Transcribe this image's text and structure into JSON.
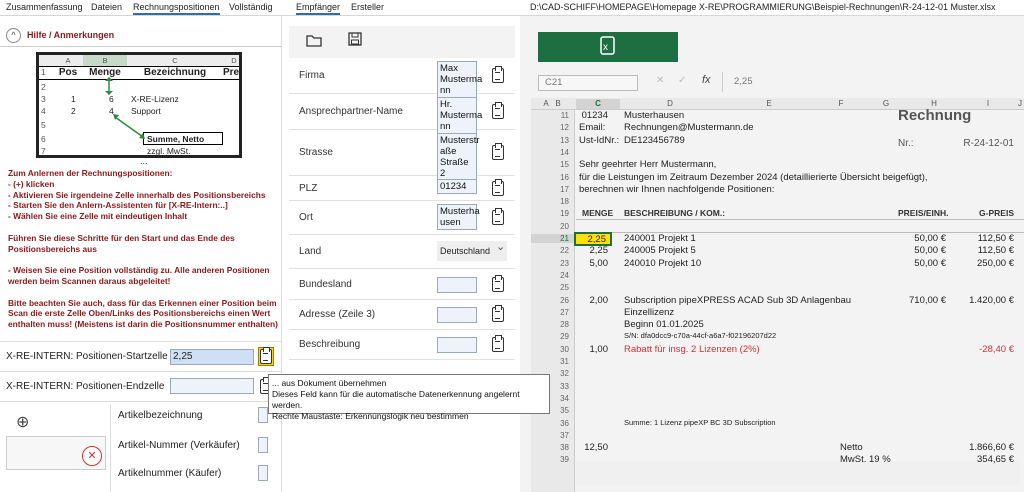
{
  "tabs_left": [
    "Zusammenfassung",
    "Dateien",
    "Rechnungspositionen",
    "Vollständig"
  ],
  "tabs_mid": [
    "Empfänger",
    "Ersteller"
  ],
  "file_path": "D:\\CAD-SCHIFF\\HOMEPAGE\\Homepage X-RE\\PROGRAMMIERUNG\\Beispiel-Rechnungen\\R-24-12-01 Muster.xlsx",
  "hilfe": {
    "toggle": "^",
    "title": "Hilfe / Anmerkungen"
  },
  "sheet": {
    "cols": [
      "A",
      "B",
      "C",
      "D"
    ],
    "headers": [
      "Pos",
      "Menge",
      "Bezeichnung",
      "Pre"
    ],
    "rows": [
      {
        "n": "1"
      },
      {
        "n": "2"
      },
      {
        "n": "3",
        "pos": "1",
        "menge": "6",
        "bez": "X-RE-Lizenz"
      },
      {
        "n": "4",
        "pos": "2",
        "menge": "4",
        "bez": "Support"
      },
      {
        "n": "5"
      },
      {
        "n": "6",
        "bez": "Summe, Netto"
      },
      {
        "n": "7",
        "bez": "zzgl. MwSt."
      }
    ],
    "more": "..."
  },
  "instructions": [
    "Zum Anlernen der Rechnungspositionen:",
    "- (+) klicken",
    "- Aktivieren Sie irgendeine Zelle innerhalb des Positionsbereichs",
    "- Starten Sie den Anlern-Assistenten für [X-RE-Intern:..]",
    "- Wählen Sie eine Zelle mit eindeutigen Inhalt",
    "",
    "Führen Sie diese Schritte für den Start und das Ende des",
    "Positionsbereichs aus",
    "",
    "- Weisen Sie eine Position vollständig zu. Alle anderen Positionen",
    "werden beim Scannen daraus abgeleitet!",
    "",
    "Bitte beachten Sie auch, dass für das Erkennen einer Position beim",
    "Scan die erste Zelle Oben/Links des Positionsbereichs einen Wert",
    "enthalten muss! (Meistens ist darin die Positionsnummer enthalten)"
  ],
  "start_cell": {
    "label": "X-RE-INTERN: Positionen-Startzelle",
    "value": "2,25"
  },
  "end_cell": {
    "label": "X-RE-INTERN: Positionen-Endzelle",
    "value": ""
  },
  "article_fields": [
    "Artikelbezeichnung",
    "Artikel-Nummer (Verkäufer)",
    "Artikelnummer (Käufer)"
  ],
  "plus": "⊕",
  "close": "✕",
  "tooltip": [
    "... aus Dokument übernehmen",
    "Dieses Feld kann für die automatische Datenerkennung angelernt werden.",
    "Rechte Maustaste: Erkennungslogik neu bestimmen"
  ],
  "recipient": {
    "icons": [
      "folder-icon",
      "save-icon"
    ],
    "fields": [
      {
        "label": "Firma",
        "value": "Max Musterma nn GmbH"
      },
      {
        "label": "Ansprechpartner-Name",
        "value": "Hr. Musterma nn"
      },
      {
        "label": "Strasse",
        "value": "Musterstr aße Straße 2"
      },
      {
        "label": "PLZ",
        "value": "01234"
      },
      {
        "label": "Ort",
        "value": "Musterha usen"
      },
      {
        "label": "Land",
        "value": "Deutschland"
      },
      {
        "label": "Bundesland",
        "value": ""
      },
      {
        "label": "Adresse (Zeile 3)",
        "value": ""
      },
      {
        "label": "Beschreibung",
        "value": ""
      }
    ]
  },
  "excel": {
    "ribbon_icon": "x",
    "namebox": "C21",
    "formula": "2,25",
    "fx": "fx",
    "cols": [
      "A",
      "B",
      "C",
      "D",
      "E",
      "F",
      "G",
      "H",
      "I",
      "J"
    ],
    "rows": [
      {
        "n": "11",
        "cells": [
          {
            "c": "c",
            "t": "01234"
          },
          {
            "c": "d",
            "t": "Musterhausen"
          },
          {
            "c": "h",
            "t": "Rechnung",
            "big": true
          }
        ]
      },
      {
        "n": "12",
        "cells": [
          {
            "c": "c",
            "t": "Email:"
          },
          {
            "c": "d",
            "t": "Rechnungen@Mustermann.de"
          }
        ]
      },
      {
        "n": "13",
        "cells": [
          {
            "c": "c",
            "t": "Ust-IdNr.:"
          },
          {
            "c": "d",
            "t": "DE123456789"
          },
          {
            "c": "h",
            "t": "Nr.:"
          },
          {
            "c": "i",
            "t": "R-24-12-01"
          }
        ]
      },
      {
        "n": "14",
        "cells": []
      },
      {
        "n": "15",
        "cells": [
          {
            "c": "c",
            "t": "Sehr geehrter Herr Mustermann,"
          }
        ]
      },
      {
        "n": "16",
        "cells": [
          {
            "c": "c",
            "t": "für die Leistungen im Zeitraum Dezember 2024 (detaillierierte Übersicht beigefügt),"
          }
        ]
      },
      {
        "n": "17",
        "cells": [
          {
            "c": "c",
            "t": "berechnen wir Ihnen nachfolgende Positionen:"
          }
        ]
      },
      {
        "n": "18",
        "cells": []
      },
      {
        "n": "19",
        "cells": [
          {
            "c": "c",
            "t": "MENGE"
          },
          {
            "c": "d",
            "t": "BESCHREIBUNG / KOM.:"
          },
          {
            "c": "h",
            "t": "PREIS/EINH."
          },
          {
            "c": "i",
            "t": "G-PREIS"
          }
        ]
      },
      {
        "n": "20",
        "cells": []
      },
      {
        "n": "21",
        "cells": [
          {
            "c": "c",
            "t": "2,25",
            "sel": true
          },
          {
            "c": "d",
            "t": "240001 Projekt 1"
          },
          {
            "c": "h",
            "t": "50,00 €"
          },
          {
            "c": "i",
            "t": "112,50 €"
          }
        ]
      },
      {
        "n": "22",
        "cells": [
          {
            "c": "c",
            "t": "2,25"
          },
          {
            "c": "d",
            "t": "240005 Projekt 5"
          },
          {
            "c": "h",
            "t": "50,00 €"
          },
          {
            "c": "i",
            "t": "112,50 €"
          }
        ]
      },
      {
        "n": "23",
        "cells": [
          {
            "c": "c",
            "t": "5,00"
          },
          {
            "c": "d",
            "t": "240010 Projekt 10"
          },
          {
            "c": "h",
            "t": "50,00 €"
          },
          {
            "c": "i",
            "t": "250,00 €"
          }
        ]
      },
      {
        "n": "24",
        "cells": []
      },
      {
        "n": "25",
        "cells": []
      },
      {
        "n": "26",
        "cells": [
          {
            "c": "c",
            "t": "2,00"
          },
          {
            "c": "d",
            "t": "Subscription pipeXPRESS ACAD Sub 3D Anlagenbau"
          },
          {
            "c": "g",
            "t": "710,00 €"
          },
          {
            "c": "i",
            "t": "1.420,00 €"
          }
        ]
      },
      {
        "n": "27",
        "cells": [
          {
            "c": "d",
            "t": "Einzellizenz"
          }
        ]
      },
      {
        "n": "28",
        "cells": [
          {
            "c": "d",
            "t": "Beginn 01.01.2025"
          }
        ]
      },
      {
        "n": "29",
        "cells": [
          {
            "c": "d",
            "t": "S/N: dfa0dcc9-c70a-44cf-a6a7-f02196207d22",
            "small": true
          }
        ]
      },
      {
        "n": "30",
        "cells": [
          {
            "c": "c",
            "t": "1,00"
          },
          {
            "c": "d",
            "t": "Rabatt für insg. 2 Lizenzen (2%)",
            "red": true
          },
          {
            "c": "i",
            "t": "-28,40 €",
            "red": true
          }
        ]
      },
      {
        "n": "31",
        "cells": []
      },
      {
        "n": "32",
        "cells": []
      },
      {
        "n": "33",
        "cells": []
      },
      {
        "n": "34",
        "cells": []
      },
      {
        "n": "35",
        "cells": []
      },
      {
        "n": "36",
        "cells": [
          {
            "c": "d",
            "t": "Summe: 1 Lizenz pipeXP BC 3D Subscription",
            "small": true
          }
        ]
      },
      {
        "n": "37",
        "cells": []
      },
      {
        "n": "38",
        "cells": [
          {
            "c": "c",
            "t": "12,50"
          },
          {
            "c": "g",
            "t": "Netto"
          },
          {
            "c": "i",
            "t": "1.866,60 €"
          }
        ]
      },
      {
        "n": "39",
        "cells": [
          {
            "c": "g",
            "t": "MwSt. 19 %"
          },
          {
            "c": "i",
            "t": "354,65 €"
          }
        ]
      }
    ]
  }
}
